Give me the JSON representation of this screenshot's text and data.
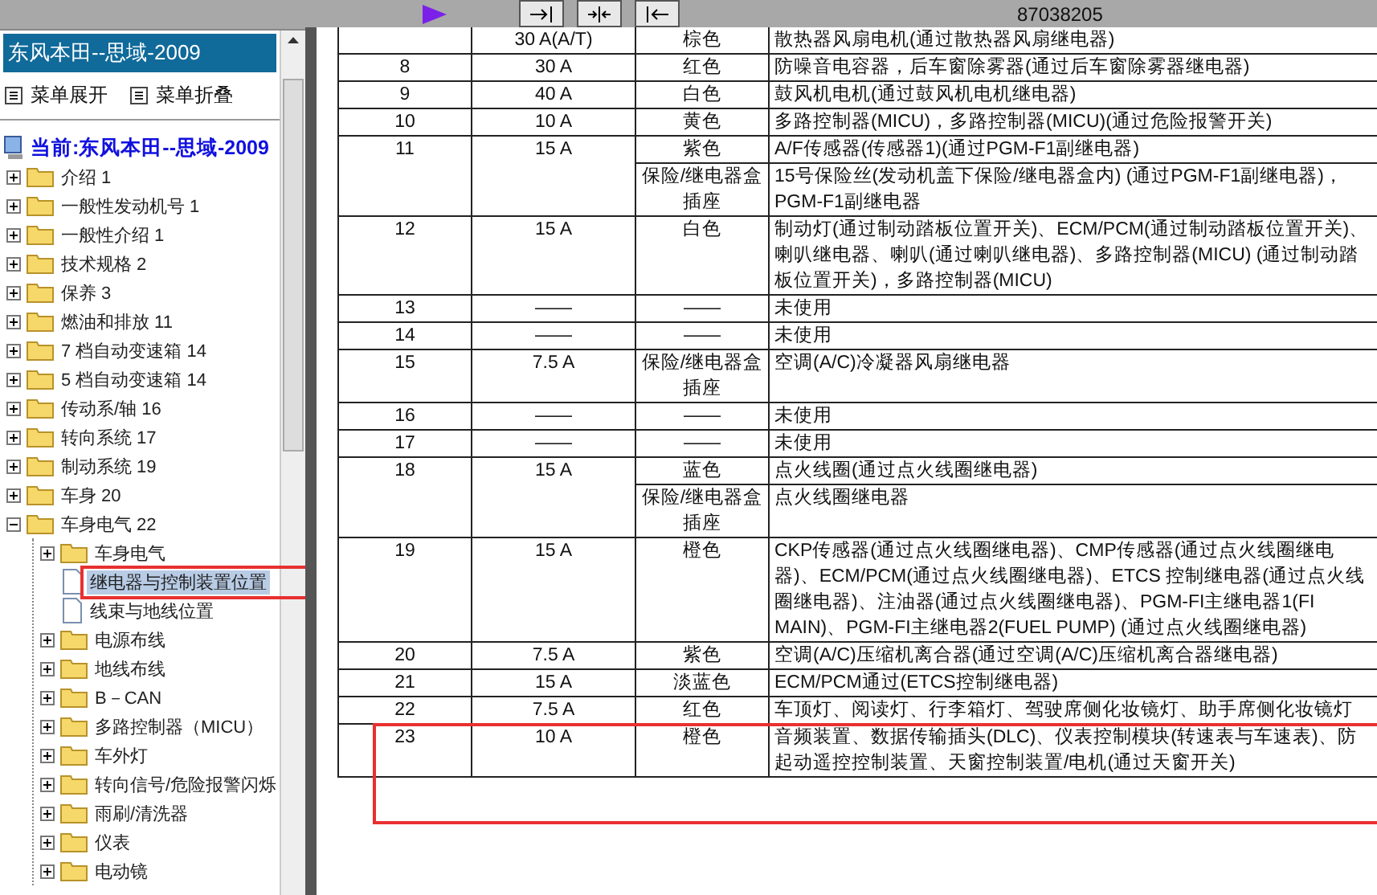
{
  "sidebar": {
    "title": "东风本田--思域-2009",
    "menu_buttons": [
      "菜单展开",
      "菜单折叠"
    ],
    "tree": {
      "label": "当前:东风本田--思域-2009",
      "children": [
        {
          "label": "介绍 1",
          "kind": "folder",
          "expanded": false,
          "selected": false
        },
        {
          "label": "一般性发动机号 1",
          "kind": "folder",
          "expanded": false,
          "selected": false
        },
        {
          "label": "一般性介绍 1",
          "kind": "folder",
          "expanded": false,
          "selected": false
        },
        {
          "label": "技术规格 2",
          "kind": "folder",
          "expanded": false,
          "selected": false
        },
        {
          "label": "保养 3",
          "kind": "folder",
          "expanded": false,
          "selected": false
        },
        {
          "label": "燃油和排放 11",
          "kind": "folder",
          "expanded": false,
          "selected": false
        },
        {
          "label": "7 档自动变速箱 14",
          "kind": "folder",
          "expanded": false,
          "selected": false
        },
        {
          "label": "5 档自动变速箱 14",
          "kind": "folder",
          "expanded": false,
          "selected": false
        },
        {
          "label": "传动系/轴 16",
          "kind": "folder",
          "expanded": false,
          "selected": false
        },
        {
          "label": "转向系统 17",
          "kind": "folder",
          "expanded": false,
          "selected": false
        },
        {
          "label": "制动系统 19",
          "kind": "folder",
          "expanded": false,
          "selected": false
        },
        {
          "label": "车身 20",
          "kind": "folder",
          "expanded": false,
          "selected": false
        },
        {
          "label": "车身电气 22",
          "kind": "folder",
          "expanded": true,
          "selected": false,
          "children": [
            {
              "label": "车身电气",
              "kind": "folder",
              "expanded": false,
              "selected": false
            },
            {
              "label": "继电器与控制装置位置",
              "kind": "page",
              "selected": true
            },
            {
              "label": "线束与地线位置",
              "kind": "page",
              "selected": false
            },
            {
              "label": "电源布线",
              "kind": "folder",
              "expanded": false,
              "selected": false
            },
            {
              "label": "地线布线",
              "kind": "folder",
              "expanded": false,
              "selected": false
            },
            {
              "label": "B－CAN",
              "kind": "folder",
              "expanded": false,
              "selected": false
            },
            {
              "label": "多路控制器（MICU）",
              "kind": "folder",
              "expanded": false,
              "selected": false
            },
            {
              "label": "车外灯",
              "kind": "folder",
              "expanded": false,
              "selected": false
            },
            {
              "label": "转向信号/危险报警闪烁",
              "kind": "folder",
              "expanded": false,
              "selected": false
            },
            {
              "label": "雨刷/清洗器",
              "kind": "folder",
              "expanded": false,
              "selected": false
            },
            {
              "label": "仪表",
              "kind": "folder",
              "expanded": false,
              "selected": false
            },
            {
              "label": "电动镜",
              "kind": "folder",
              "expanded": false,
              "selected": false
            }
          ]
        }
      ]
    }
  },
  "toolbar": {
    "code": "87038205"
  },
  "table": {
    "rows": [
      {
        "number": "",
        "rating": "30 A(A/T)",
        "circuits": [
          {
            "wire": "棕色",
            "description": "散热器风扇电机(通过散热器风扇继电器)"
          }
        ]
      },
      {
        "number": "8",
        "rating": "30 A",
        "circuits": [
          {
            "wire": "红色",
            "description": "防噪音电容器，后车窗除雾器(通过后车窗除雾器继电器)"
          }
        ]
      },
      {
        "number": "9",
        "rating": "40 A",
        "circuits": [
          {
            "wire": "白色",
            "description": "鼓风机电机(通过鼓风机电机继电器)"
          }
        ]
      },
      {
        "number": "10",
        "rating": "10 A",
        "circuits": [
          {
            "wire": "黄色",
            "description": "多路控制器(MICU)，多路控制器(MICU)(通过危险报警开关)"
          }
        ]
      },
      {
        "number": "11",
        "rating": "15 A",
        "circuits": [
          {
            "wire": "紫色",
            "description": "A/F传感器(传感器1)(通过PGM-F1副继电器)"
          },
          {
            "wire": "保险/继电器盒插座",
            "description": "15号保险丝(发动机盖下保险/继电器盒内) (通过PGM-F1副继电器)，PGM-F1副继电器"
          }
        ]
      },
      {
        "number": "12",
        "rating": "15 A",
        "circuits": [
          {
            "wire": "白色",
            "description": "制动灯(通过制动踏板位置开关)、ECM/PCM(通过制动踏板位置开关)、喇叭继电器、喇叭(通过喇叭继电器)、多路控制器(MICU) (通过制动踏板位置开关)，多路控制器(MICU)"
          }
        ]
      },
      {
        "number": "13",
        "rating": "——",
        "circuits": [
          {
            "wire": "——",
            "description": "未使用"
          }
        ]
      },
      {
        "number": "14",
        "rating": "——",
        "circuits": [
          {
            "wire": "——",
            "description": "未使用"
          }
        ]
      },
      {
        "number": "15",
        "rating": "7.5 A",
        "circuits": [
          {
            "wire": "保险/继电器盒插座",
            "description": "空调(A/C)冷凝器风扇继电器"
          }
        ]
      },
      {
        "number": "16",
        "rating": "——",
        "circuits": [
          {
            "wire": "——",
            "description": "未使用"
          }
        ]
      },
      {
        "number": "17",
        "rating": "——",
        "circuits": [
          {
            "wire": "——",
            "description": "未使用"
          }
        ]
      },
      {
        "number": "18",
        "rating": "15 A",
        "circuits": [
          {
            "wire": "蓝色",
            "description": "点火线圈(通过点火线圈继电器)"
          },
          {
            "wire": "保险/继电器盒插座",
            "description": "点火线圈继电器"
          }
        ]
      },
      {
        "number": "19",
        "rating": "15 A",
        "circuits": [
          {
            "wire": "橙色",
            "description": "CKP传感器(通过点火线圈继电器)、CMP传感器(通过点火线圈继电器)、ECM/PCM(通过点火线圈继电器)、ETCS 控制继电器(通过点火线圈继电器)、注油器(通过点火线圈继电器)、PGM-FI主继电器1(FI MAIN)、PGM-FI主继电器2(FUEL PUMP) (通过点火线圈继电器)"
          }
        ]
      },
      {
        "number": "20",
        "rating": "7.5 A",
        "circuits": [
          {
            "wire": "紫色",
            "description": "空调(A/C)压缩机离合器(通过空调(A/C)压缩机离合器继电器)"
          }
        ]
      },
      {
        "number": "21",
        "rating": "15 A",
        "circuits": [
          {
            "wire": "淡蓝色",
            "description": "ECM/PCM通过(ETCS控制继电器)"
          }
        ]
      },
      {
        "number": "22",
        "rating": "7.5 A",
        "circuits": [
          {
            "wire": "红色",
            "description": "车顶灯、阅读灯、行李箱灯、驾驶席侧化妆镜灯、助手席侧化妆镜灯"
          }
        ]
      },
      {
        "number": "23",
        "rating": "10 A",
        "circuits": [
          {
            "wire": "橙色",
            "description": "音频装置、数据传输插头(DLC)、仪表控制模块(转速表与车速表)、防起动遥控控制装置、天窗控制装置/电机(通过天窗开关)"
          }
        ]
      }
    ]
  }
}
